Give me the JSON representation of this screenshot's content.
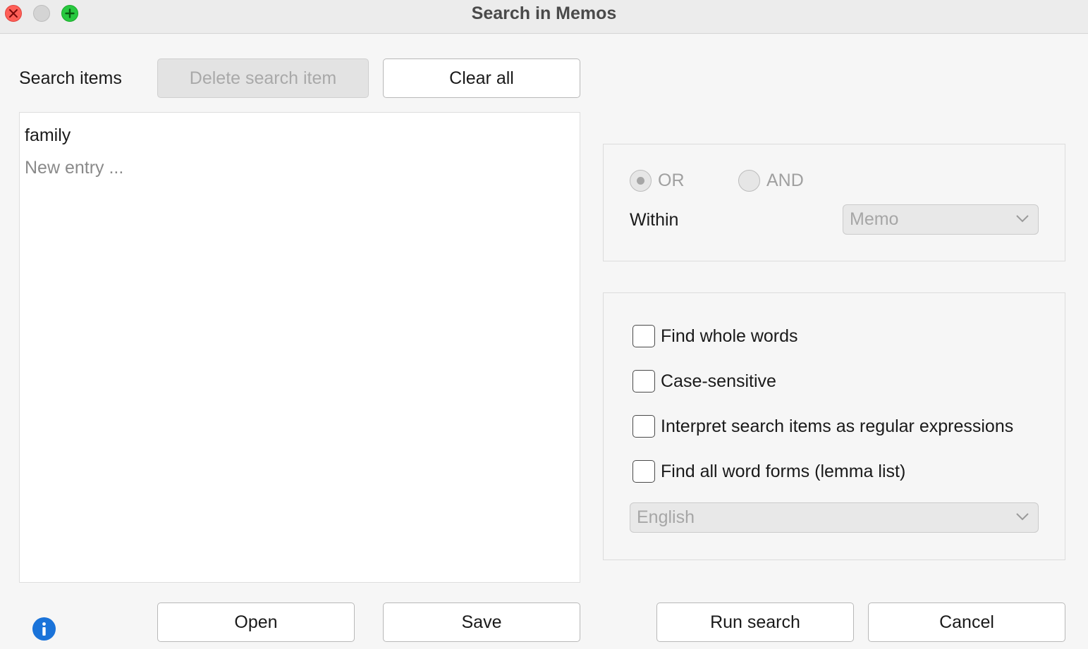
{
  "window": {
    "title": "Search in Memos"
  },
  "search_items": {
    "label": "Search items",
    "delete_button": "Delete search item",
    "clear_button": "Clear all",
    "entries": [
      "family"
    ],
    "new_entry_placeholder": "New entry ..."
  },
  "logic": {
    "or_label": "OR",
    "and_label": "AND",
    "selected": "OR",
    "within_label": "Within",
    "within_value": "Memo"
  },
  "options": {
    "whole_words": "Find whole words",
    "case_sensitive": "Case-sensitive",
    "regex": "Interpret search items as regular expressions",
    "word_forms": "Find all word forms (lemma list)",
    "language_value": "English"
  },
  "footer": {
    "open_button": "Open",
    "save_button": "Save",
    "run_button": "Run search",
    "cancel_button": "Cancel"
  },
  "icons": {
    "close": "close-icon",
    "minimize": "minimize-icon",
    "zoom": "zoom-icon",
    "info": "info-icon",
    "dropdown": "chevron-down-icon"
  }
}
